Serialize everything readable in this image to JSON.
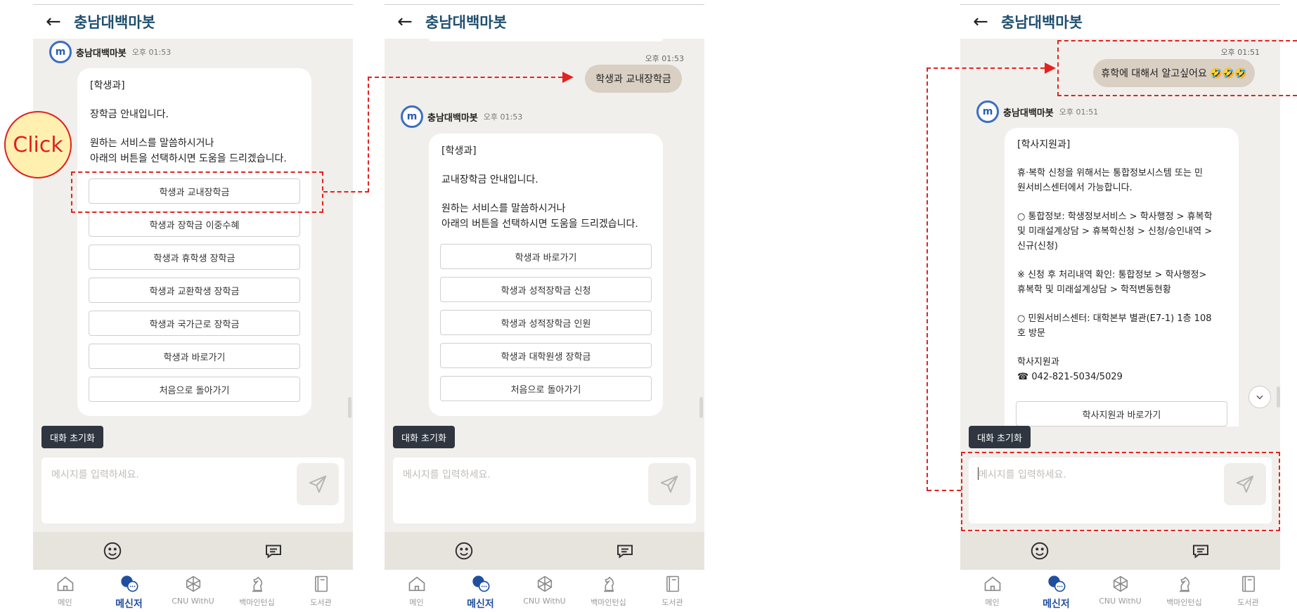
{
  "header": {
    "back_glyph": "←",
    "title": "충남대백마봇"
  },
  "bot": {
    "name": "충남대백마봇",
    "avatar_text": "m"
  },
  "screen1": {
    "bot_time": "오후 01:53",
    "message": {
      "dept": "[학생과]",
      "line1": "장학금 안내입니다.",
      "line2": "원하는 서비스를 말씀하시거나",
      "line3": "아래의 버튼을 선택하시면 도움을 드리겠습니다."
    },
    "options": [
      "학생과 교내장학금",
      "학생과 장학금 이중수혜",
      "학생과 휴학생 장학금",
      "학생과 교환학생 장학금",
      "학생과 국가근로 장학금",
      "학생과 바로가기",
      "처음으로 돌아가기"
    ]
  },
  "screen2": {
    "user_time": "오후 01:53",
    "user_message": "학생과 교내장학금",
    "bot_time": "오후 01:53",
    "message": {
      "dept": "[학생과]",
      "line1": "교내장학금 안내입니다.",
      "line2": "원하는 서비스를 말씀하시거나",
      "line3": "아래의 버튼을 선택하시면 도움을 드리겠습니다."
    },
    "options": [
      "학생과 바로가기",
      "학생과 성적장학금 신청",
      "학생과 성적장학금 인원",
      "학생과 대학원생 장학금",
      "처음으로 돌아가기"
    ]
  },
  "screen3": {
    "user_time": "오후 01:51",
    "user_message": "휴학에 대해서 알고싶어요 🤣🤣🤣",
    "bot_time": "오후 01:51",
    "message": {
      "dept": "[학사지원과]",
      "p1a": "휴·복학 신청을 위해서는 통합정보시스템 또는 민",
      "p1b": "원서비스센터에서 가능합니다.",
      "p2a": "○ 통합정보: 학생정보서비스 > 학사행정 > 휴복학",
      "p2b": "및 미래설계상담 > 휴복학신청 > 신청/승인내역 >",
      "p2c": "신규(신청)",
      "p3a": "※ 신청 후 처리내역 확인: 통합정보 > 학사행정>",
      "p3b": "휴복학 및 미래설계상담 > 학적변동현황",
      "p4a": "○ 민원서비스센터: 대학본부 별관(E7-1) 1층 108",
      "p4b": "호 방문",
      "p5a": "학사지원과",
      "p5b": "☎ 042-821-5034/5029"
    },
    "options": [
      "학사지원과 바로가기"
    ]
  },
  "reset_label": "대화 초기화",
  "input_placeholder": "메시지를 입력하세요.",
  "nav": [
    "메인",
    "메신저",
    "CNU WithU",
    "백마인턴십",
    "도서관"
  ],
  "annotation": {
    "callout_text": "Click",
    "accent_color": "#e32222"
  }
}
